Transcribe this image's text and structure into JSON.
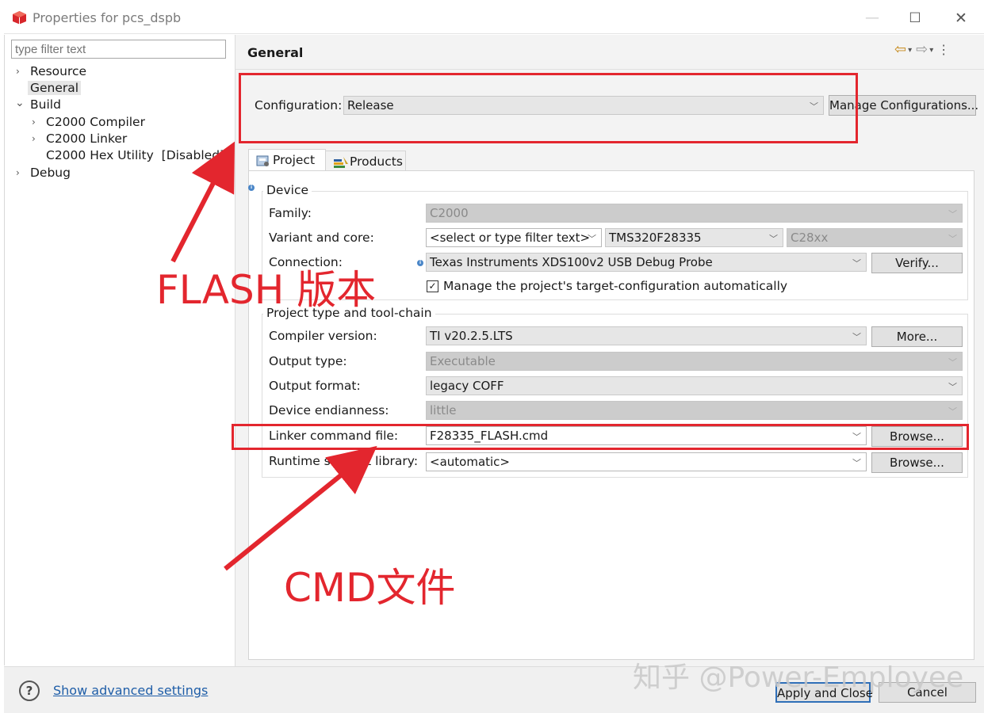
{
  "window": {
    "title": "Properties for pcs_dspb",
    "minimize": "—",
    "maximize": "☐",
    "close": "✕"
  },
  "sidebar": {
    "filter_placeholder": "type filter text",
    "items": [
      {
        "label": "Resource",
        "expander": "›"
      },
      {
        "label": "General",
        "selected": true
      },
      {
        "label": "Build",
        "expander": "⌄"
      },
      {
        "label": "C2000 Compiler",
        "expander": "›"
      },
      {
        "label": "C2000 Linker",
        "expander": "›"
      },
      {
        "label": "C2000 Hex Utility  [Disabled]"
      },
      {
        "label": "Debug",
        "expander": "›"
      }
    ]
  },
  "header": {
    "title": "General",
    "back_icon": "⇦",
    "forward_icon": "⇨",
    "dropdown_icon": "▾",
    "menu_icon": "⋮"
  },
  "configuration": {
    "label": "Configuration:",
    "value": "Release",
    "manage_button": "Manage Configurations..."
  },
  "tabs": [
    {
      "label": "Project",
      "icon": "project-icon",
      "active": true
    },
    {
      "label": "Products",
      "icon": "products-icon",
      "active": false
    }
  ],
  "device": {
    "title": "Device",
    "family_label": "Family:",
    "family_value": "C2000",
    "variant_label": "Variant and core:",
    "variant_filter": "<select or type filter text>",
    "variant_value": "TMS320F28335",
    "core_value": "C28xx",
    "connection_label": "Connection:",
    "connection_value": "Texas Instruments XDS100v2 USB Debug Probe",
    "verify_button": "Verify...",
    "manage_checkbox_label": "Manage the project's target-configuration automatically",
    "manage_checked": true
  },
  "toolchain": {
    "title": "Project type and tool-chain",
    "compiler_label": "Compiler version:",
    "compiler_value": "TI v20.2.5.LTS",
    "more_button": "More...",
    "output_type_label": "Output type:",
    "output_type_value": "Executable",
    "output_format_label": "Output format:",
    "output_format_value": "legacy COFF",
    "endianness_label": "Device endianness:",
    "endianness_value": "little",
    "linker_label": "Linker command file:",
    "linker_value": "F28335_FLASH.cmd",
    "linker_browse": "Browse...",
    "runtime_label": "Runtime support library:",
    "runtime_value": "<automatic>",
    "runtime_browse": "Browse..."
  },
  "footer": {
    "help_icon": "?",
    "advanced_link": "Show advanced settings",
    "apply_close": "Apply and Close",
    "cancel": "Cancel"
  },
  "annotations": {
    "flash_text": "FLASH 版本",
    "cmd_text": "CMD文件",
    "color": "#e3262e"
  },
  "watermark": "知乎 @Power-Employee"
}
